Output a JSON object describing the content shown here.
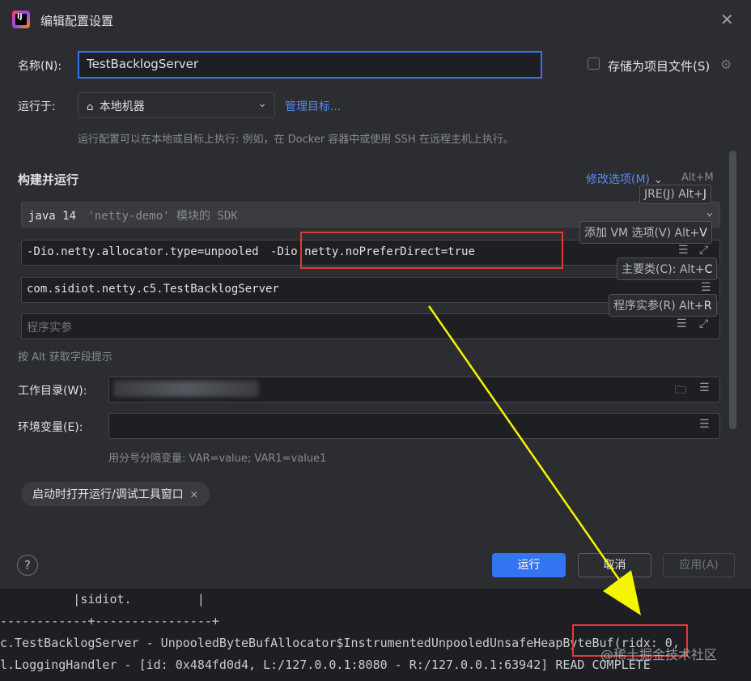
{
  "dialog": {
    "title": "编辑配置设置",
    "name_label": "名称(N):",
    "name_value": "TestBacklogServer",
    "store_checkbox_label": "存储为项目文件(S)",
    "run_on_label": "运行于:",
    "run_on_value": "本地机器",
    "manage_targets": "管理目标...",
    "run_on_hint": "运行配置可以在本地或目标上执行: 例如，在 Docker 容器中或使用 SSH 在远程主机上执行。",
    "build_run_title": "构建并运行",
    "modify_options": "修改选项(M)",
    "modify_shortcut": "Alt+M",
    "sdk_text": "java 14",
    "sdk_module": "'netty-demo' 模块的 SDK",
    "vm_options_a": "-Dio.netty.allocator.type=unpooled",
    "vm_options_b": "-Dio.netty.noPreferDirect=true",
    "main_class": "com.sidiot.netty.c5.TestBacklogServer",
    "program_args_placeholder": "程序实参",
    "alt_hint": "按 Alt 获取字段提示",
    "workdir_label": "工作目录(W):",
    "env_label": "环境变量(E):",
    "env_hint": "用分号分隔变量: VAR=value; VAR1=value1",
    "open_tool_window_chip": "启动时打开运行/调试工具窗口",
    "run_button": "运行",
    "cancel_button": "取消",
    "apply_button": "应用(A)"
  },
  "tooltips": {
    "jre": "JRE(J) Alt+",
    "jre_key": "J",
    "vm": "添加 VM 选项(V) Alt+",
    "vm_key": "V",
    "main": "主要类(C): Alt+",
    "main_key": "C",
    "args": "程序实参(R) Alt+",
    "args_key": "R"
  },
  "console": {
    "line1": "          |sidiot.         |",
    "line2": "------------+----------------+",
    "line3": "c.TestBacklogServer - UnpooledByteBufAllocator$InstrumentedUnpooledUnsafeHeapByteBuf(ridx: 0,",
    "line4": "l.LoggingHandler - [id: 0x484fd0d4, L:/127.0.0.1:8080 - R:/127.0.0.1:63942] READ COMPLETE"
  },
  "watermark": "@稀土掘金技术社区",
  "colors": {
    "accent": "#3574f0",
    "highlight_box": "#e53935",
    "arrow": "#f5f500"
  },
  "icons": [
    "app-logo-icon",
    "close-icon",
    "gear-icon",
    "home-icon",
    "chevron-down-icon",
    "list-icon",
    "expand-icon",
    "folder-icon",
    "help-icon"
  ]
}
